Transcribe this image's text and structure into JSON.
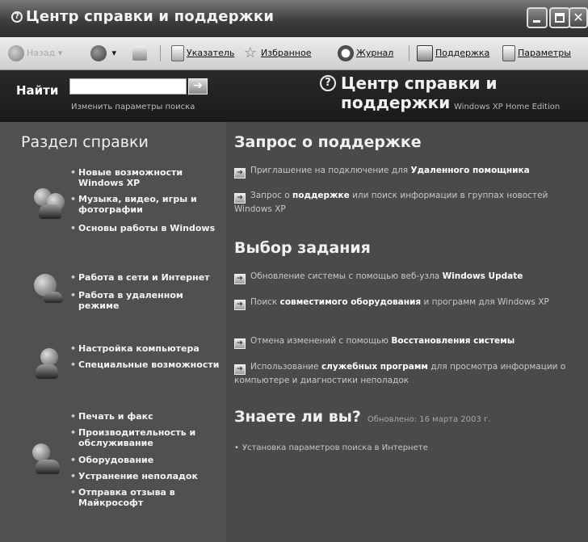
{
  "window": {
    "title": "Центр справки и поддержки"
  },
  "toolbar": {
    "back": "Назад",
    "index": "Указатель",
    "favorites": "Избранное",
    "history": "Журнал",
    "support": "Поддержка",
    "options": "Параметры"
  },
  "search": {
    "label": "Найти",
    "value": "",
    "options_link": "Изменить параметры поиска"
  },
  "header": {
    "title": "Центр справки и поддержки",
    "edition": "Windows XP Home Edition"
  },
  "help_topics": {
    "title": "Раздел справки",
    "groups": [
      {
        "icon": "people-icon",
        "items": [
          "Новые возможности Windows XP",
          "Музыка, видео, игры и фотографии",
          "Основы работы в Windows"
        ]
      },
      {
        "icon": "network-icon",
        "items": [
          "Работа в сети и Интернет",
          "Работа в удаленном режиме"
        ]
      },
      {
        "icon": "user-settings-icon",
        "items": [
          "Настройка компьютера",
          "Специальные возможности"
        ]
      },
      {
        "icon": "printer-icon",
        "items": [
          "Печать и факс",
          "Производительность и обслуживание",
          "Оборудование",
          "Устранение неполадок",
          "Отправка отзыва в Майкрософт"
        ]
      }
    ]
  },
  "support_request": {
    "title": "Запрос о поддержке",
    "items": [
      {
        "pre": "Приглашение на подключение для ",
        "bold": "Удаленного помощника",
        "post": ""
      },
      {
        "pre": "Запрос о ",
        "bold": "поддержке",
        "post": " или поиск информации в группах новостей Windows XP"
      }
    ]
  },
  "pick_task": {
    "title": "Выбор задания",
    "items": [
      {
        "pre": "Обновление системы с помощью веб-узла ",
        "bold": "Windows Update",
        "post": ""
      },
      {
        "pre": "Поиск ",
        "bold": "совместимого оборудования",
        "post": " и программ для Windows XP"
      },
      {
        "pre": "Отмена изменений с помощью ",
        "bold": "Восстановления системы",
        "post": ""
      },
      {
        "pre": "Использование ",
        "bold": "служебных программ",
        "post": " для просмотра информации о компьютере и диагностики неполадок"
      }
    ]
  },
  "did_you_know": {
    "title": "Знаете ли вы?",
    "date": "Обновлено: 16 марта 2003 г.",
    "items": [
      "Установка параметров поиска в Интернете"
    ]
  }
}
